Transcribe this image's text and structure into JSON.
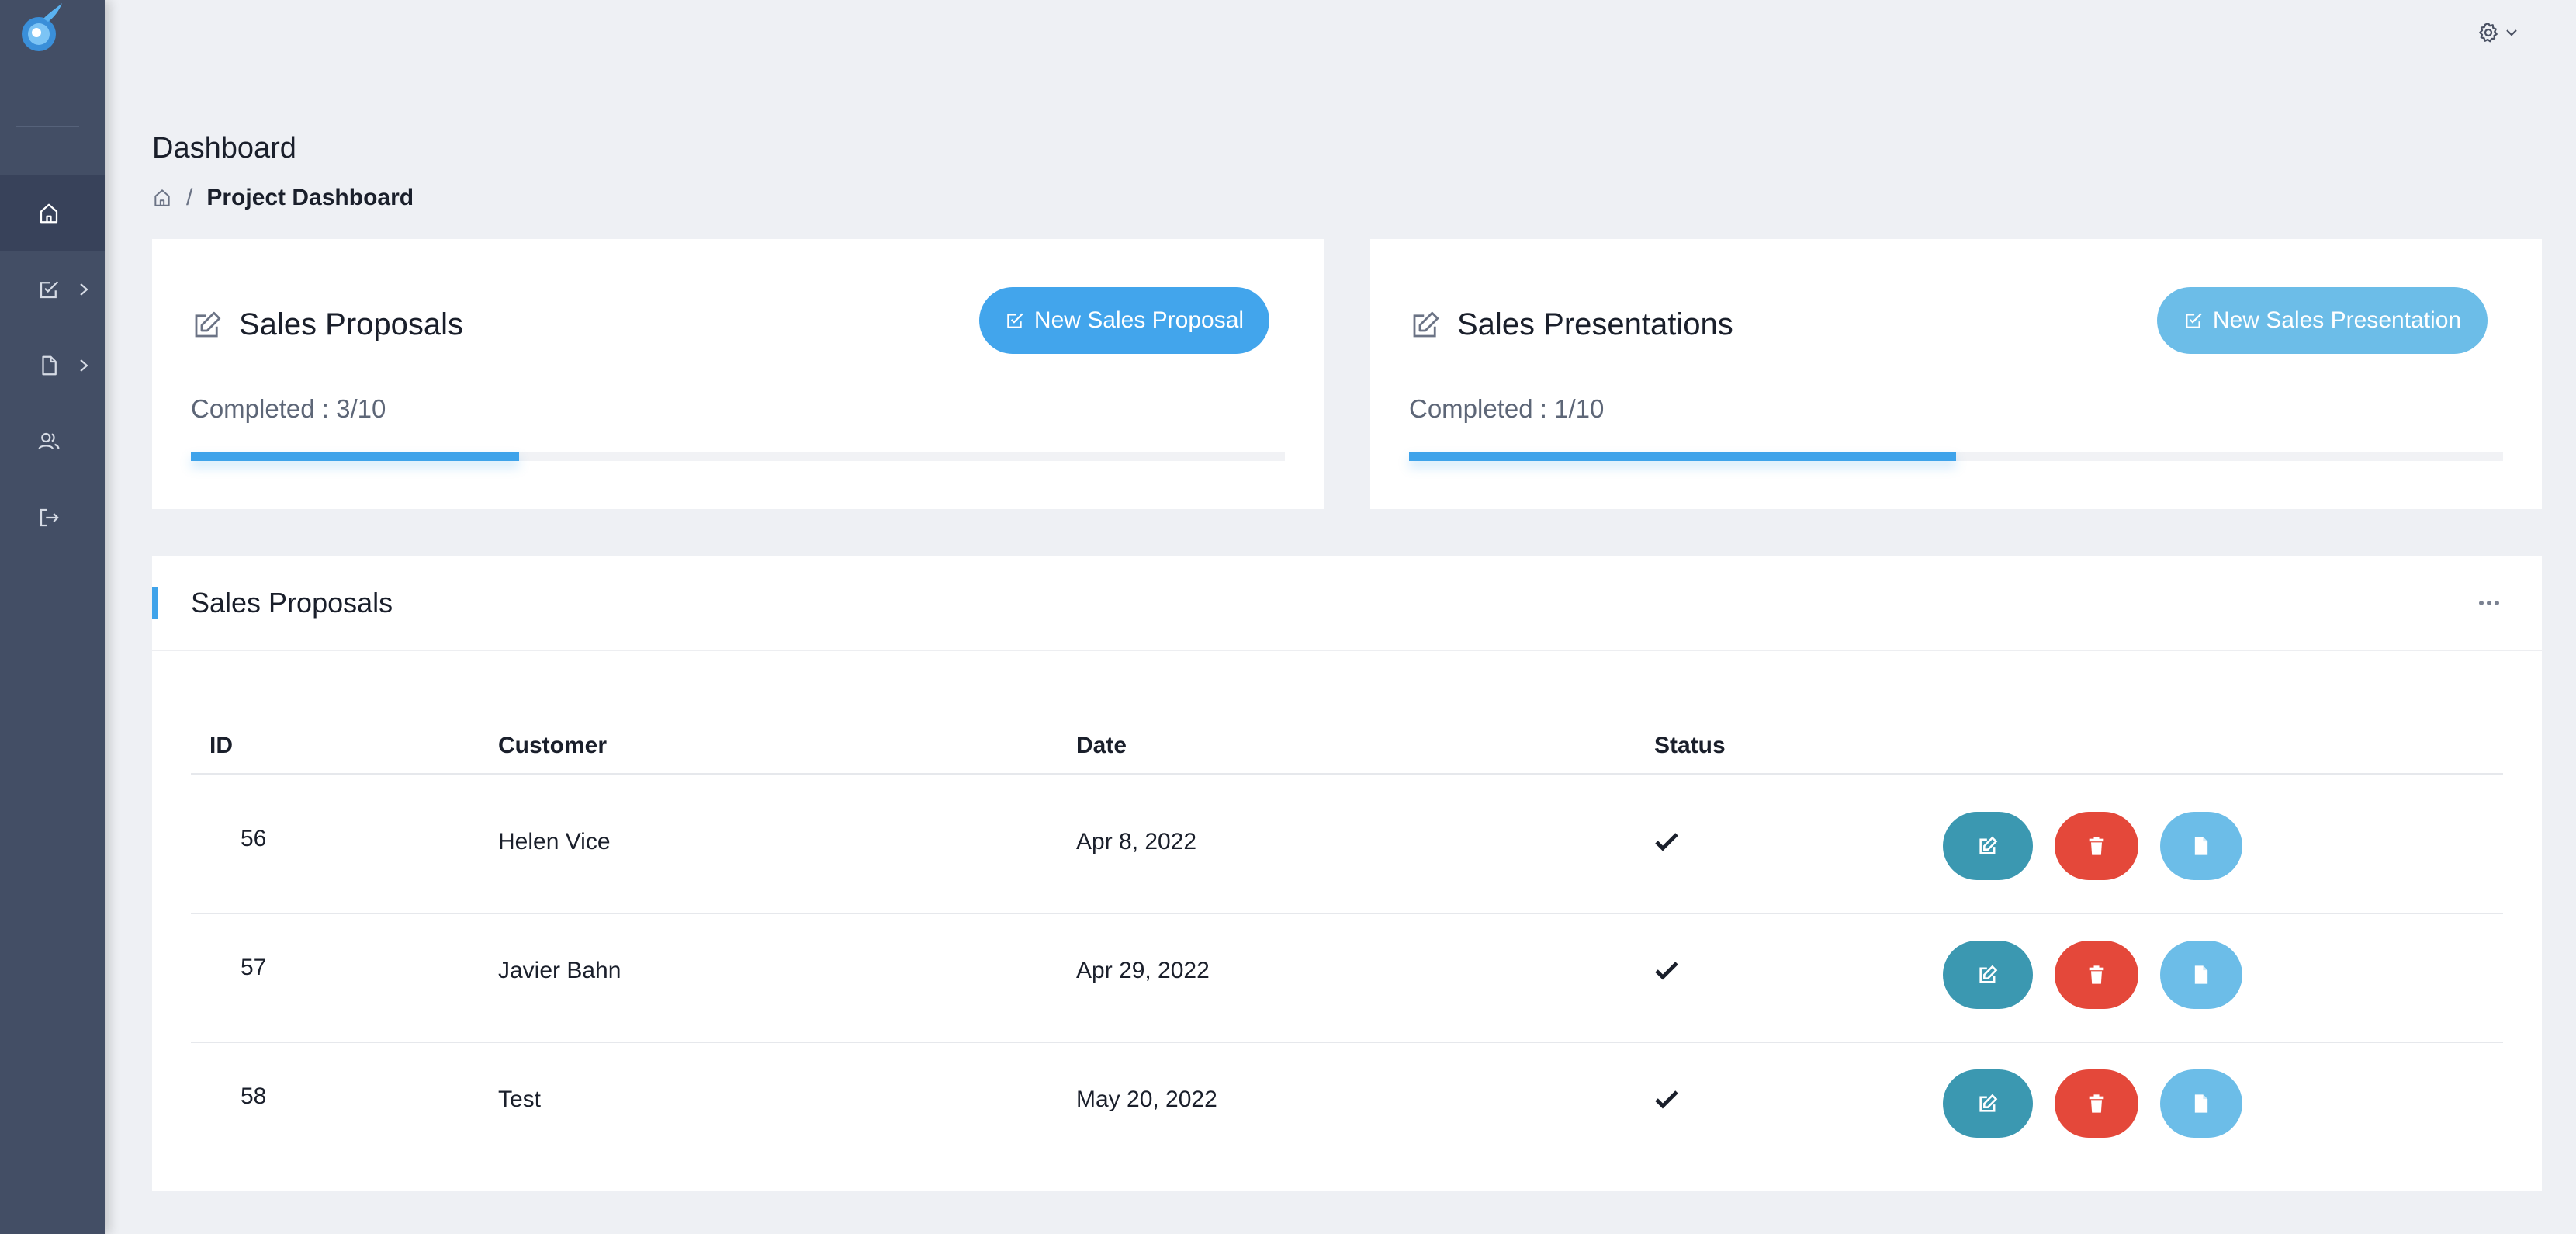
{
  "sidebar": {
    "items": [
      {
        "icon": "home-icon",
        "active": true
      },
      {
        "icon": "checkbox-edit-icon",
        "has_submenu": true
      },
      {
        "icon": "document-icon",
        "has_submenu": true
      },
      {
        "icon": "users-icon"
      },
      {
        "icon": "logout-icon"
      }
    ]
  },
  "header": {
    "title": "Dashboard",
    "breadcrumb": {
      "separator": "/",
      "current": "Project Dashboard"
    }
  },
  "cards": {
    "proposals": {
      "title": "Sales Proposals",
      "button_label": "New Sales Proposal",
      "completed_label": "Completed : 3/10",
      "progress": 0.3
    },
    "presentations": {
      "title": "Sales Presentations",
      "button_label": "New Sales Presentation",
      "completed_label": "Completed : 1/10",
      "progress": 0.5
    }
  },
  "table": {
    "title": "Sales Proposals",
    "columns": [
      "ID",
      "Customer",
      "Date",
      "Status"
    ],
    "rows": [
      {
        "id": "56",
        "customer": "Helen Vice",
        "date": "Apr 8, 2022",
        "status": "complete"
      },
      {
        "id": "57",
        "customer": "Javier Bahn",
        "date": "Apr 29, 2022",
        "status": "complete"
      },
      {
        "id": "58",
        "customer": "Test",
        "date": "May 20, 2022",
        "status": "complete"
      }
    ]
  },
  "colors": {
    "sidebar": "#434e65",
    "accent": "#42a5ec",
    "edit": "#3b98b1",
    "delete": "#e4483a",
    "doc": "#6cbde8"
  }
}
